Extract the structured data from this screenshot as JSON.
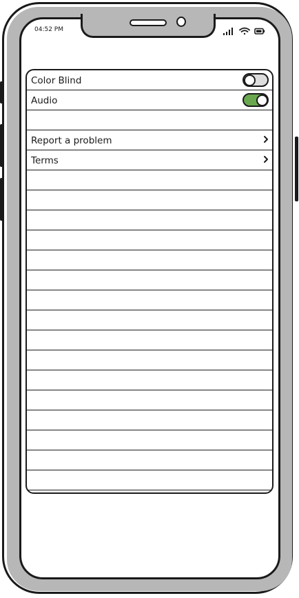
{
  "status_bar": {
    "time": "04:52 PM",
    "icons": [
      "signal-icon",
      "wifi-icon",
      "battery-icon"
    ]
  },
  "settings": {
    "toggles": [
      {
        "label": "Color Blind",
        "on": false
      },
      {
        "label": "Audio",
        "on": true
      }
    ],
    "links": [
      {
        "label": "Report a problem",
        "icon": "chevron-right-icon"
      },
      {
        "label": "Terms",
        "icon": "chevron-right-icon"
      }
    ],
    "empty_rows": 16
  },
  "colors": {
    "frame": "#1a1a1a",
    "bezel": "#b7b7b7",
    "toggle_on": "#6aa84f",
    "toggle_off": "#dddddd",
    "background": "#ffffff"
  }
}
